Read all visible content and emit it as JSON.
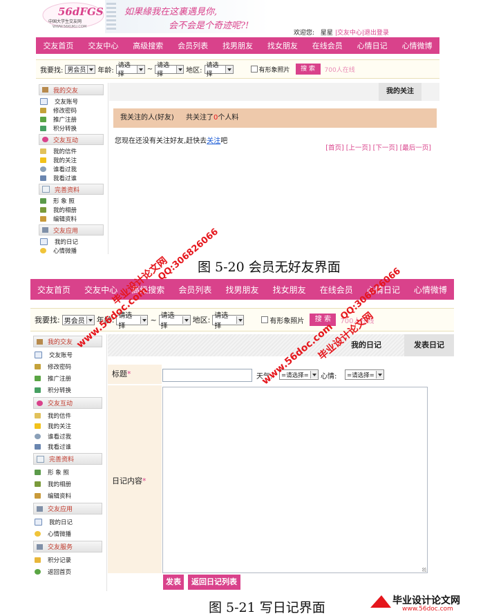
{
  "top_shot": {
    "logo_text": "56dFGS",
    "logo_sub1": "中国大学生交友网",
    "logo_sub2": "WWW.56KUKU.COM",
    "slogan_1": "如果緣我在这裏遇見你,",
    "slogan_2": "会不会是个奇迹呢?!",
    "welcome_prefix": "欢迎您:",
    "welcome_user": "星星",
    "welcome_links": "|交友中心|退出登录",
    "nav": [
      "交友首页",
      "交友中心",
      "高级搜索",
      "会员列表",
      "找男朋友",
      "找女朋友",
      "在线会员",
      "心情日记",
      "心情微博"
    ],
    "search": {
      "label": "我要找:",
      "gender": "男会员",
      "age_label": "年龄:",
      "age_from": "请选择",
      "tilde": "~",
      "age_to": "请选择",
      "area_label": "地区:",
      "area": "请选择",
      "photo_label": "有形象照片",
      "button": "搜 索",
      "online": "700人在线"
    },
    "tab_title": "我的关注",
    "follow_box": {
      "left": "我关注的人(好友)",
      "prefix": "共关注了",
      "count": "0",
      "suffix": "个人料"
    },
    "empty_text": "您现在还没有关注好友,赶快去",
    "empty_link": "关注",
    "empty_tail": "吧",
    "pager": "[首页] [上一页] [下一页] [最后一页]"
  },
  "sidebar": {
    "groups": [
      {
        "title": "我的交友",
        "items": [
          "交友账号",
          "修改密码",
          "推广注册",
          "积分转换"
        ]
      },
      {
        "title": "交友互动",
        "items": [
          "我的信件",
          "我的关注",
          "谁看过我",
          "我看过谁"
        ]
      },
      {
        "title": "完善资料",
        "items": [
          "形 象 照",
          "我的相册",
          "编辑资料"
        ]
      },
      {
        "title": "交友应用",
        "items": [
          "我的日记",
          "心情微播"
        ]
      },
      {
        "title": "交友服务",
        "items": [
          "积分记录",
          "返回首页"
        ]
      }
    ]
  },
  "caption_1": "图 5-20  会员无好友界面",
  "bottom_shot": {
    "nav": [
      "交友首页",
      "交友中心",
      "高级搜索",
      "会员列表",
      "找男朋友",
      "找女朋友",
      "在线会员",
      "心情日记",
      "心情微博"
    ],
    "search": {
      "label": "我要找:",
      "gender": "男会员",
      "age_label": "年龄:",
      "age_from": "请选择",
      "tilde": "~",
      "age_to": "请选择",
      "area_label": "地区:",
      "area": "请选择",
      "photo_label": "有形象照片",
      "button": "搜 索",
      "online": "700人在线"
    },
    "tabs": [
      "我的日记",
      "发表日记"
    ],
    "form": {
      "title_label": "标题",
      "weather_label": "天气:",
      "weather": "=请选择=",
      "mood_label": "心情:",
      "mood": "=请选择=",
      "content_label": "日记内容"
    },
    "buttons": [
      "发表",
      "返回日记列表"
    ]
  },
  "caption_2": "图 5-21    写日记界面",
  "watermarks": {
    "site": "www.56doc.com",
    "qq": "QQ:306826066",
    "name": "毕业设计论文网"
  },
  "footer_logo": {
    "title": "毕业设计论文网",
    "url": "www.56doc.com"
  }
}
